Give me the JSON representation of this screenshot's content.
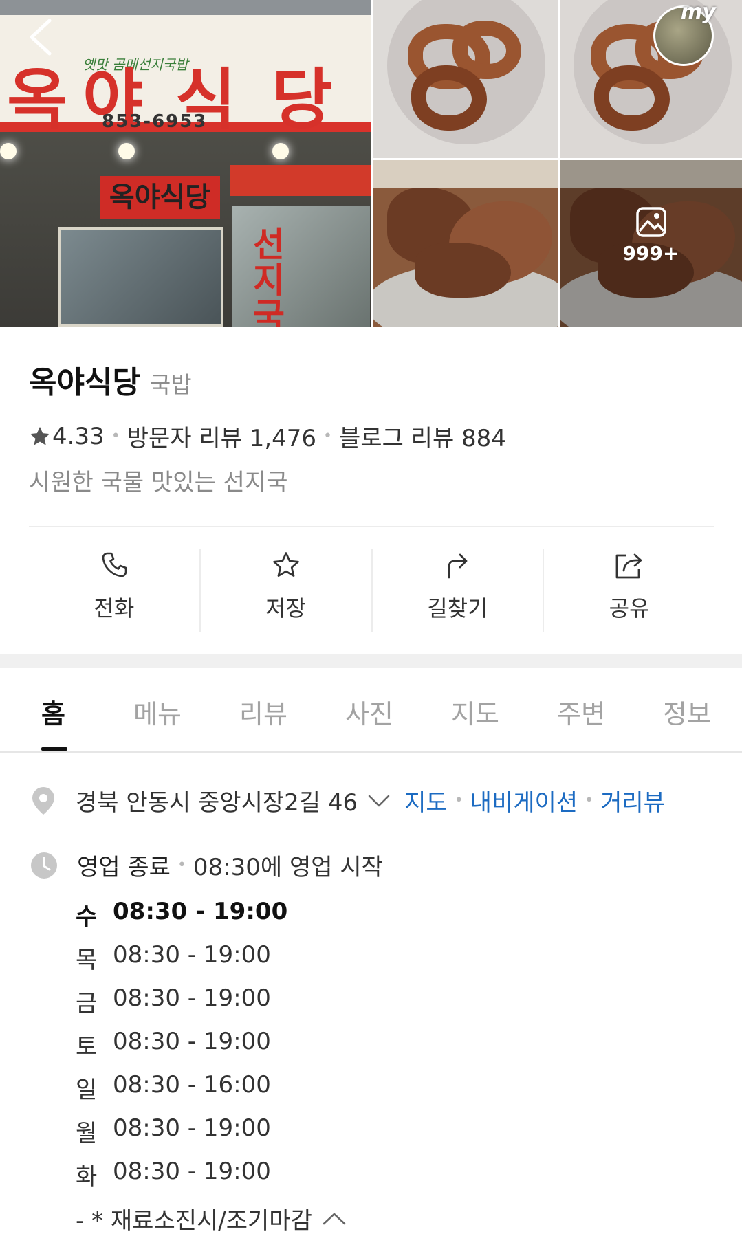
{
  "photos": {
    "storefront_sign": "옥 야 식 당",
    "storefront_phone": "853-6953",
    "storefront_lower_sign": "옥야식당",
    "storefront_vertical": "선지국",
    "my_badge": "my",
    "photo_count": "999+"
  },
  "place": {
    "name": "옥야식당",
    "category": "국밥",
    "rating": "4.33",
    "visitor_reviews": "방문자 리뷰 1,476",
    "blog_reviews": "블로그 리뷰 884",
    "description": "시원한 국물 맛있는 선지국"
  },
  "actions": [
    {
      "label": "전화",
      "icon": "phone-icon"
    },
    {
      "label": "저장",
      "icon": "star-icon"
    },
    {
      "label": "길찾기",
      "icon": "directions-icon"
    },
    {
      "label": "공유",
      "icon": "share-icon"
    }
  ],
  "tabs": [
    "홈",
    "메뉴",
    "리뷰",
    "사진",
    "지도",
    "주변",
    "정보"
  ],
  "address": {
    "text": "경북 안동시 중앙시장2길 46",
    "links": [
      "지도",
      "내비게이션",
      "거리뷰"
    ]
  },
  "hours": {
    "status": "영업 종료",
    "next": "08:30에 영업 시작",
    "schedule": [
      {
        "day": "수",
        "time": "08:30 - 19:00",
        "today": true
      },
      {
        "day": "목",
        "time": "08:30 - 19:00"
      },
      {
        "day": "금",
        "time": "08:30 - 19:00"
      },
      {
        "day": "토",
        "time": "08:30 - 19:00"
      },
      {
        "day": "일",
        "time": "08:30 - 16:00"
      },
      {
        "day": "월",
        "time": "08:30 - 19:00"
      },
      {
        "day": "화",
        "time": "08:30 - 19:00"
      }
    ],
    "note": "- * 재료소진시/조기마감"
  },
  "colors": {
    "link": "#1c6bc2",
    "sign_red": "#d6312a",
    "muted": "#8d8d8d"
  }
}
